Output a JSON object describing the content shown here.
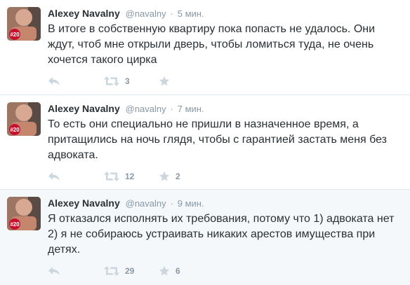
{
  "colors": {
    "text": "#292f33",
    "muted": "#8899a6",
    "icon": "#ccd6dd",
    "divider": "#e1e8ed",
    "highlight_bg": "#f5f8fa",
    "badge": "#c8102e"
  },
  "icons": {
    "reply": "reply-icon",
    "retweet": "retweet-icon",
    "favorite": "star-icon"
  },
  "tweets": [
    {
      "name": "Alexey Navalny",
      "handle": "@navalny",
      "separator": "·",
      "time": "5 мин.",
      "avatar_badge": "#20",
      "text": "В итоге в собственную квартиру пока попасть не удалось. Они ждут, чтоб мне открыли дверь, чтобы ломиться туда, не очень хочется такого цирка",
      "retweets": "3",
      "favorites": ""
    },
    {
      "name": "Alexey Navalny",
      "handle": "@navalny",
      "separator": "·",
      "time": "7 мин.",
      "avatar_badge": "#20",
      "text": "То есть они специально не пришли в назначенное время, а притащились на ночь глядя, чтобы с гарантией застать меня без адвоката.",
      "retweets": "12",
      "favorites": "2"
    },
    {
      "name": "Alexey Navalny",
      "handle": "@navalny",
      "separator": "·",
      "time": "9 мин.",
      "avatar_badge": "#20",
      "text": "Я отказался исполнять их требования, потому что 1) адвоката нет 2) я не собираюсь устраивать никаких арестов имущества при детях.",
      "retweets": "29",
      "favorites": "6"
    }
  ]
}
